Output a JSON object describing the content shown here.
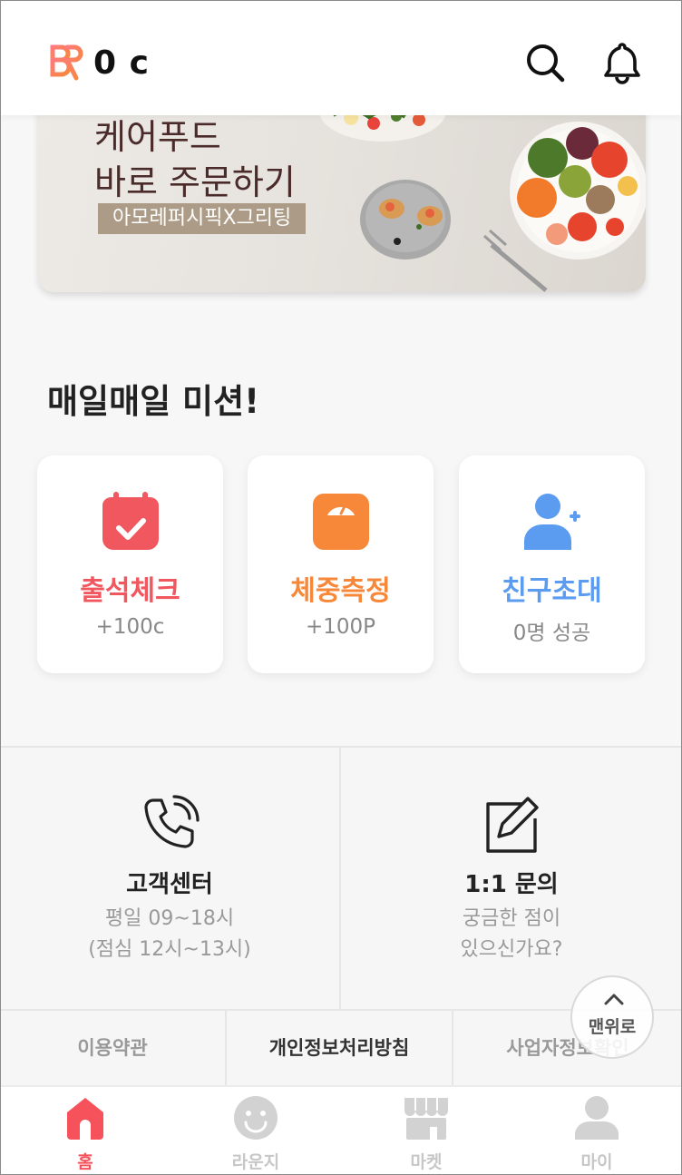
{
  "header": {
    "point_value": "0 c",
    "icons": {
      "logo": "brand-logo-icon",
      "search": "search-icon",
      "notification": "bell-icon"
    }
  },
  "banner": {
    "title": "케어푸드\n바로 주문하기",
    "tag": "아모레퍼시픽X그리팅"
  },
  "mission": {
    "title": "매일매일 미션!",
    "cards": [
      {
        "label": "출석체크",
        "sub": "+100c",
        "color": "#f0575f",
        "icon": "calendar-check-icon"
      },
      {
        "label": "체중측정",
        "sub": "+100P",
        "color": "#f7883a",
        "icon": "scale-icon"
      },
      {
        "label": "친구초대",
        "sub": "0명 성공",
        "color": "#5b9cf0",
        "icon": "add-user-icon"
      }
    ]
  },
  "support": {
    "customer_center": {
      "title": "고객센터",
      "line1": "평일 09~18시",
      "line2": "(점심 12시~13시)",
      "icon": "phone-icon"
    },
    "inquiry": {
      "title": "1:1 문의",
      "line1": "궁금한 점이",
      "line2": "있으신가요?",
      "icon": "edit-icon"
    }
  },
  "links": {
    "terms": "이용약관",
    "privacy": "개인정보처리방침",
    "business": "사업자정보확인"
  },
  "top_button": {
    "label": "맨위로",
    "icon": "chevron-up-icon"
  },
  "tabs": [
    {
      "name": "홈",
      "icon": "home-icon",
      "active": true
    },
    {
      "name": "라운지",
      "icon": "smile-icon",
      "active": false
    },
    {
      "name": "마켓",
      "icon": "store-icon",
      "active": false
    },
    {
      "name": "마이",
      "icon": "user-icon",
      "active": false
    }
  ],
  "colors": {
    "accent": "#f5525b",
    "inactive": "#c7c7c7",
    "banner_tag": "#ac9b86"
  }
}
